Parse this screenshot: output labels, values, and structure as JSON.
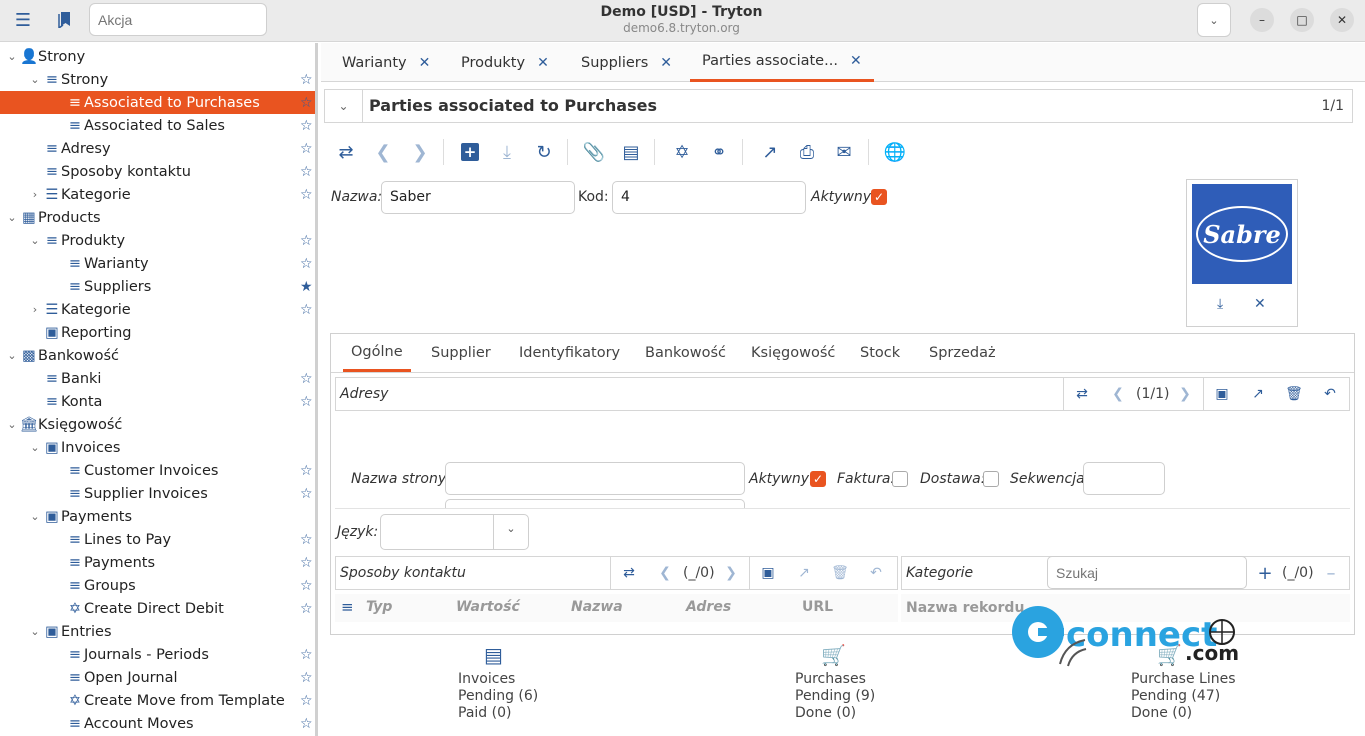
{
  "window": {
    "title": "Demo [USD] - Tryton",
    "subtitle": "demo6.8.tryton.org",
    "search_placeholder": "Akcja"
  },
  "sidebar": {
    "items": [
      {
        "label": "Strony",
        "level": 0,
        "icon": "person-icon",
        "expanded": true,
        "star": null
      },
      {
        "label": "Strony",
        "level": 1,
        "icon": "list-icon",
        "expanded": true,
        "star": "empty"
      },
      {
        "label": "Associated to Purchases",
        "level": 2,
        "icon": "list-icon",
        "selected": true,
        "star": "empty"
      },
      {
        "label": "Associated to Sales",
        "level": 2,
        "icon": "list-icon",
        "star": "empty"
      },
      {
        "label": "Adresy",
        "level": 1,
        "icon": "list-icon",
        "star": "empty"
      },
      {
        "label": "Sposoby kontaktu",
        "level": 1,
        "icon": "list-icon",
        "star": "empty"
      },
      {
        "label": "Kategorie",
        "level": 1,
        "icon": "tree-list-icon",
        "expanded": false,
        "star": "empty"
      },
      {
        "label": "Products",
        "level": 0,
        "icon": "products-icon",
        "expanded": true,
        "star": null
      },
      {
        "label": "Produkty",
        "level": 1,
        "icon": "list-icon",
        "expanded": true,
        "star": "empty"
      },
      {
        "label": "Warianty",
        "level": 2,
        "icon": "list-icon",
        "star": "empty"
      },
      {
        "label": "Suppliers",
        "level": 2,
        "icon": "list-icon",
        "star": "filled"
      },
      {
        "label": "Kategorie",
        "level": 1,
        "icon": "tree-list-icon",
        "expanded": false,
        "star": "empty"
      },
      {
        "label": "Reporting",
        "level": 1,
        "icon": "folder-icon",
        "star": null
      },
      {
        "label": "Bankowość",
        "level": 0,
        "icon": "money-icon",
        "expanded": true,
        "star": null
      },
      {
        "label": "Banki",
        "level": 1,
        "icon": "list-icon",
        "star": "empty"
      },
      {
        "label": "Konta",
        "level": 1,
        "icon": "list-icon",
        "star": "empty"
      },
      {
        "label": "Księgowość",
        "level": 0,
        "icon": "bank-icon",
        "expanded": true,
        "star": null
      },
      {
        "label": "Invoices",
        "level": 1,
        "icon": "folder-icon",
        "expanded": true,
        "star": null
      },
      {
        "label": "Customer Invoices",
        "level": 2,
        "icon": "list-icon",
        "star": "empty"
      },
      {
        "label": "Supplier Invoices",
        "level": 2,
        "icon": "list-icon",
        "star": "empty"
      },
      {
        "label": "Payments",
        "level": 1,
        "icon": "folder-icon",
        "expanded": true,
        "star": null
      },
      {
        "label": "Lines to Pay",
        "level": 2,
        "icon": "list-icon",
        "star": "empty"
      },
      {
        "label": "Payments",
        "level": 2,
        "icon": "list-icon",
        "star": "empty"
      },
      {
        "label": "Groups",
        "level": 2,
        "icon": "list-icon",
        "star": "empty"
      },
      {
        "label": "Create Direct Debit",
        "level": 2,
        "icon": "wizard-icon",
        "star": "empty"
      },
      {
        "label": "Entries",
        "level": 1,
        "icon": "folder-icon",
        "expanded": true,
        "star": null
      },
      {
        "label": "Journals - Periods",
        "level": 2,
        "icon": "list-icon",
        "star": "empty"
      },
      {
        "label": "Open Journal",
        "level": 2,
        "icon": "list-icon",
        "star": "empty"
      },
      {
        "label": "Create Move from Template",
        "level": 2,
        "icon": "wizard-icon",
        "star": "empty"
      },
      {
        "label": "Account Moves",
        "level": 2,
        "icon": "list-icon",
        "star": "empty"
      }
    ]
  },
  "tabs": [
    {
      "label": "Warianty"
    },
    {
      "label": "Produkty"
    },
    {
      "label": "Suppliers"
    },
    {
      "label": "Parties associate...",
      "active": true
    }
  ],
  "header": {
    "title": "Parties associated to Purchases",
    "record_count": "1/1"
  },
  "form": {
    "name_label": "Nazwa:",
    "name_value": "Saber",
    "code_label": "Kod:",
    "code_value": "4",
    "active_label": "Aktywny:",
    "active_checked": true,
    "logo_text": "Sabre"
  },
  "notebook": {
    "tabs": [
      "Ogólne",
      "Supplier",
      "Identyfikatory",
      "Bankowość",
      "Księgowość",
      "Stock",
      "Sprzedaż"
    ],
    "active_tab": "Ogólne",
    "addresses": {
      "label": "Adresy",
      "counter": "(1/1)",
      "party_name_label": "Nazwa strony:",
      "party_name_value": "",
      "active_label": "Aktywny:",
      "active_checked": true,
      "invoice_label": "Faktura:",
      "invoice_checked": false,
      "delivery_label": "Dostawa:",
      "delivery_checked": false,
      "sequence_label": "Sekwencja:",
      "sequence_value": ""
    },
    "language_label": "Język:",
    "language_value": "",
    "contacts": {
      "label": "Sposoby kontaktu",
      "counter": "(_/0)",
      "columns": [
        "Typ",
        "Wartość",
        "Nazwa",
        "Adres",
        "URL"
      ]
    },
    "categories": {
      "label": "Kategorie",
      "search_placeholder": "Szukaj",
      "counter": "(_/0)",
      "column": "Nazwa rekordu"
    }
  },
  "dashboard": [
    {
      "title": "Invoices",
      "lines": [
        "Pending (6)",
        "Paid (0)"
      ],
      "icon": "invoice-icon"
    },
    {
      "title": "Purchases",
      "lines": [
        "Pending (9)",
        "Done (0)"
      ],
      "icon": "cart-icon"
    },
    {
      "title": "Purchase Lines",
      "lines": [
        "Pending (47)",
        "Done (0)"
      ],
      "icon": "cart-icon"
    }
  ],
  "watermark": {
    "text": "connect",
    "suffix": ".com"
  },
  "colors": {
    "accent": "#e95420",
    "icon": "#2f5d9a"
  }
}
